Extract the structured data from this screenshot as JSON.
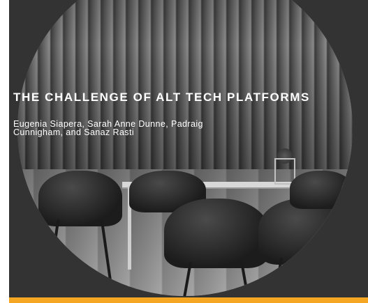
{
  "cover": {
    "title": "THE CHALLENGE OF ALT TECH PLATFORMS",
    "authors": "Eugenia Siapera, Sarah Anne Dunne, Padraig Cunnigham, and Sanaz Rasti"
  },
  "colors": {
    "background": "#333333",
    "accent": "#F5A623",
    "text": "#FFFFFF"
  }
}
